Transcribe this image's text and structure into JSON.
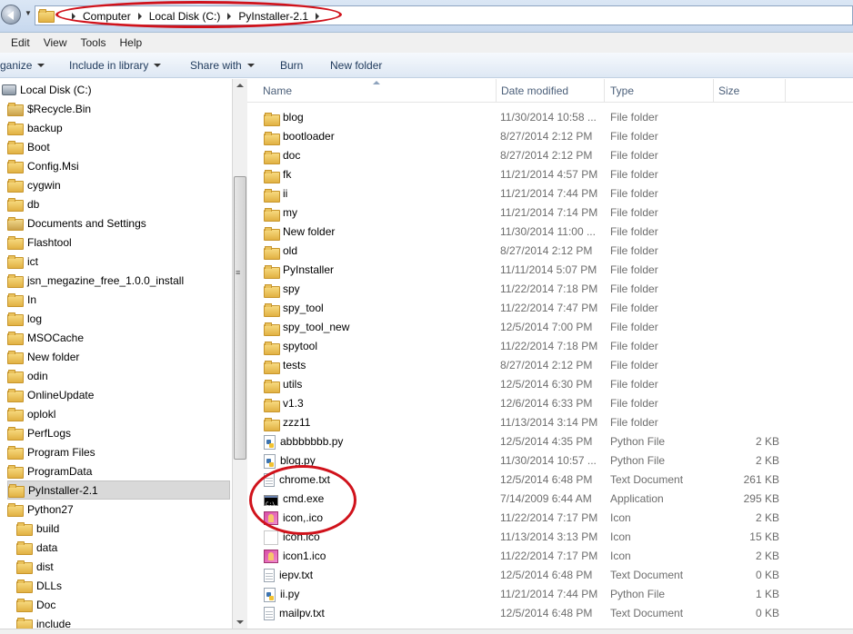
{
  "address": {
    "crumbs": [
      "Computer",
      "Local Disk (C:)",
      "PyInstaller-2.1"
    ]
  },
  "menu": [
    "Edit",
    "View",
    "Tools",
    "Help"
  ],
  "toolbar": {
    "organize": "ganize",
    "include": "Include in library",
    "share": "Share with",
    "burn": "Burn",
    "new_folder": "New folder"
  },
  "nav": {
    "root": "Local Disk (C:)",
    "items": [
      "$Recycle.Bin",
      "backup",
      "Boot",
      "Config.Msi",
      "cygwin",
      "db",
      "Documents and Settings",
      "Flashtool",
      "ict",
      "jsn_megazine_free_1.0.0_install",
      "In",
      "log",
      "MSOCache",
      "New folder",
      "odin",
      "OnlineUpdate",
      "oplokl",
      "PerfLogs",
      "Program Files",
      "ProgramData",
      "PyInstaller-2.1",
      "Python27"
    ],
    "sub_items": [
      "build",
      "data",
      "dist",
      "DLLs",
      "Doc",
      "include"
    ]
  },
  "columns": {
    "name": "Name",
    "date": "Date modified",
    "type": "Type",
    "size": "Size"
  },
  "files": [
    {
      "icon": "folder",
      "name": "blog",
      "date": "11/30/2014 10:58 ...",
      "type": "File folder",
      "size": ""
    },
    {
      "icon": "folder",
      "name": "bootloader",
      "date": "8/27/2014 2:12 PM",
      "type": "File folder",
      "size": ""
    },
    {
      "icon": "folder",
      "name": "doc",
      "date": "8/27/2014 2:12 PM",
      "type": "File folder",
      "size": ""
    },
    {
      "icon": "folder",
      "name": "fk",
      "date": "11/21/2014 4:57 PM",
      "type": "File folder",
      "size": ""
    },
    {
      "icon": "folder",
      "name": "ii",
      "date": "11/21/2014 7:44 PM",
      "type": "File folder",
      "size": ""
    },
    {
      "icon": "folder",
      "name": "my",
      "date": "11/21/2014 7:14 PM",
      "type": "File folder",
      "size": ""
    },
    {
      "icon": "folder",
      "name": "New folder",
      "date": "11/30/2014 11:00 ...",
      "type": "File folder",
      "size": ""
    },
    {
      "icon": "folder",
      "name": "old",
      "date": "8/27/2014 2:12 PM",
      "type": "File folder",
      "size": ""
    },
    {
      "icon": "folder",
      "name": "PyInstaller",
      "date": "11/11/2014 5:07 PM",
      "type": "File folder",
      "size": ""
    },
    {
      "icon": "folder",
      "name": "spy",
      "date": "11/22/2014 7:18 PM",
      "type": "File folder",
      "size": ""
    },
    {
      "icon": "folder",
      "name": "spy_tool",
      "date": "11/22/2014 7:47 PM",
      "type": "File folder",
      "size": ""
    },
    {
      "icon": "folder",
      "name": "spy_tool_new",
      "date": "12/5/2014 7:00 PM",
      "type": "File folder",
      "size": ""
    },
    {
      "icon": "folder",
      "name": "spytool",
      "date": "11/22/2014 7:18 PM",
      "type": "File folder",
      "size": ""
    },
    {
      "icon": "folder",
      "name": "tests",
      "date": "8/27/2014 2:12 PM",
      "type": "File folder",
      "size": ""
    },
    {
      "icon": "folder",
      "name": "utils",
      "date": "12/5/2014 6:30 PM",
      "type": "File folder",
      "size": ""
    },
    {
      "icon": "folder",
      "name": "v1.3",
      "date": "12/6/2014 6:33 PM",
      "type": "File folder",
      "size": ""
    },
    {
      "icon": "folder",
      "name": "zzz11",
      "date": "11/13/2014 3:14 PM",
      "type": "File folder",
      "size": ""
    },
    {
      "icon": "python",
      "name": "abbbbbbb.py",
      "date": "12/5/2014 4:35 PM",
      "type": "Python File",
      "size": "2 KB"
    },
    {
      "icon": "python",
      "name": "blog.py",
      "date": "11/30/2014 10:57 ...",
      "type": "Python File",
      "size": "2 KB"
    },
    {
      "icon": "text",
      "name": "chrome.txt",
      "date": "12/5/2014 6:48 PM",
      "type": "Text Document",
      "size": "261 KB"
    },
    {
      "icon": "app",
      "name": "cmd.exe",
      "date": "7/14/2009 6:44 AM",
      "type": "Application",
      "size": "295 KB"
    },
    {
      "icon": "ico",
      "name": "icon,.ico",
      "date": "11/22/2014 7:17 PM",
      "type": "Icon",
      "size": "2 KB"
    },
    {
      "icon": "ico-plain",
      "name": "icon.ico",
      "date": "11/13/2014 3:13 PM",
      "type": "Icon",
      "size": "15 KB"
    },
    {
      "icon": "ico",
      "name": "icon1.ico",
      "date": "11/22/2014 7:17 PM",
      "type": "Icon",
      "size": "2 KB"
    },
    {
      "icon": "text",
      "name": "iepv.txt",
      "date": "12/5/2014 6:48 PM",
      "type": "Text Document",
      "size": "0 KB"
    },
    {
      "icon": "python",
      "name": "ii.py",
      "date": "11/21/2014 7:44 PM",
      "type": "Python File",
      "size": "1 KB"
    },
    {
      "icon": "text",
      "name": "mailpv.txt",
      "date": "12/5/2014 6:48 PM",
      "type": "Text Document",
      "size": "0 KB"
    }
  ],
  "colors": {
    "annotation": "#d0121b",
    "selection": "#d9d9d9",
    "header_text": "#4c607a"
  }
}
